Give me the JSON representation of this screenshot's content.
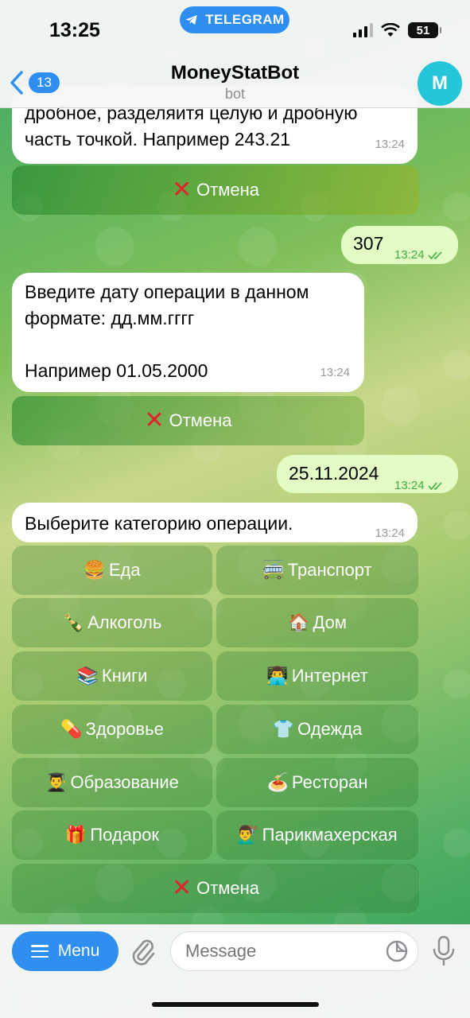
{
  "status_bar": {
    "time": "13:25",
    "app_pill": "TELEGRAM",
    "battery": "51"
  },
  "header": {
    "back_count": "13",
    "title": "MoneyStatBot",
    "subtitle": "bot",
    "avatar_letter": "M"
  },
  "messages": [
    {
      "text_line1": "дробное, разделяитя целую и дробную",
      "text_line2": "часть точкой. Например 243.21",
      "time": "13:24"
    },
    {
      "text": "307",
      "time": "13:24"
    },
    {
      "line1": "Введите дату операции в данном",
      "line2": "формате: дд.мм.гггг",
      "line3": "Например 01.05.2000",
      "time": "13:24"
    },
    {
      "text": "25.11.2024",
      "time": "13:24"
    },
    {
      "text": "Выберите категорию операции.",
      "time": "13:24"
    }
  ],
  "cancel_label": "Отмена",
  "categories": [
    {
      "emoji": "🍔",
      "label": "Еда"
    },
    {
      "emoji": "🚎",
      "label": "Транспорт"
    },
    {
      "emoji": "🍾",
      "label": "Алкоголь"
    },
    {
      "emoji": "🏠",
      "label": "Дом"
    },
    {
      "emoji": "📚",
      "label": "Книги"
    },
    {
      "emoji": "👨‍💻",
      "label": "Интернет"
    },
    {
      "emoji": "💊",
      "label": "Здоровье"
    },
    {
      "emoji": "👕",
      "label": "Одежда"
    },
    {
      "emoji": "👨‍🎓",
      "label": "Образование"
    },
    {
      "emoji": "🍝",
      "label": "Ресторан"
    },
    {
      "emoji": "🎁",
      "label": "Подарок"
    },
    {
      "emoji": "💇‍♂️",
      "label": "Парикмахерская"
    }
  ],
  "input": {
    "menu_label": "Menu",
    "placeholder": "Message"
  },
  "colors": {
    "accent": "#2f8ff0",
    "outgoing_bubble": "#e2fcc4",
    "cancel_x": "#e0232a"
  }
}
